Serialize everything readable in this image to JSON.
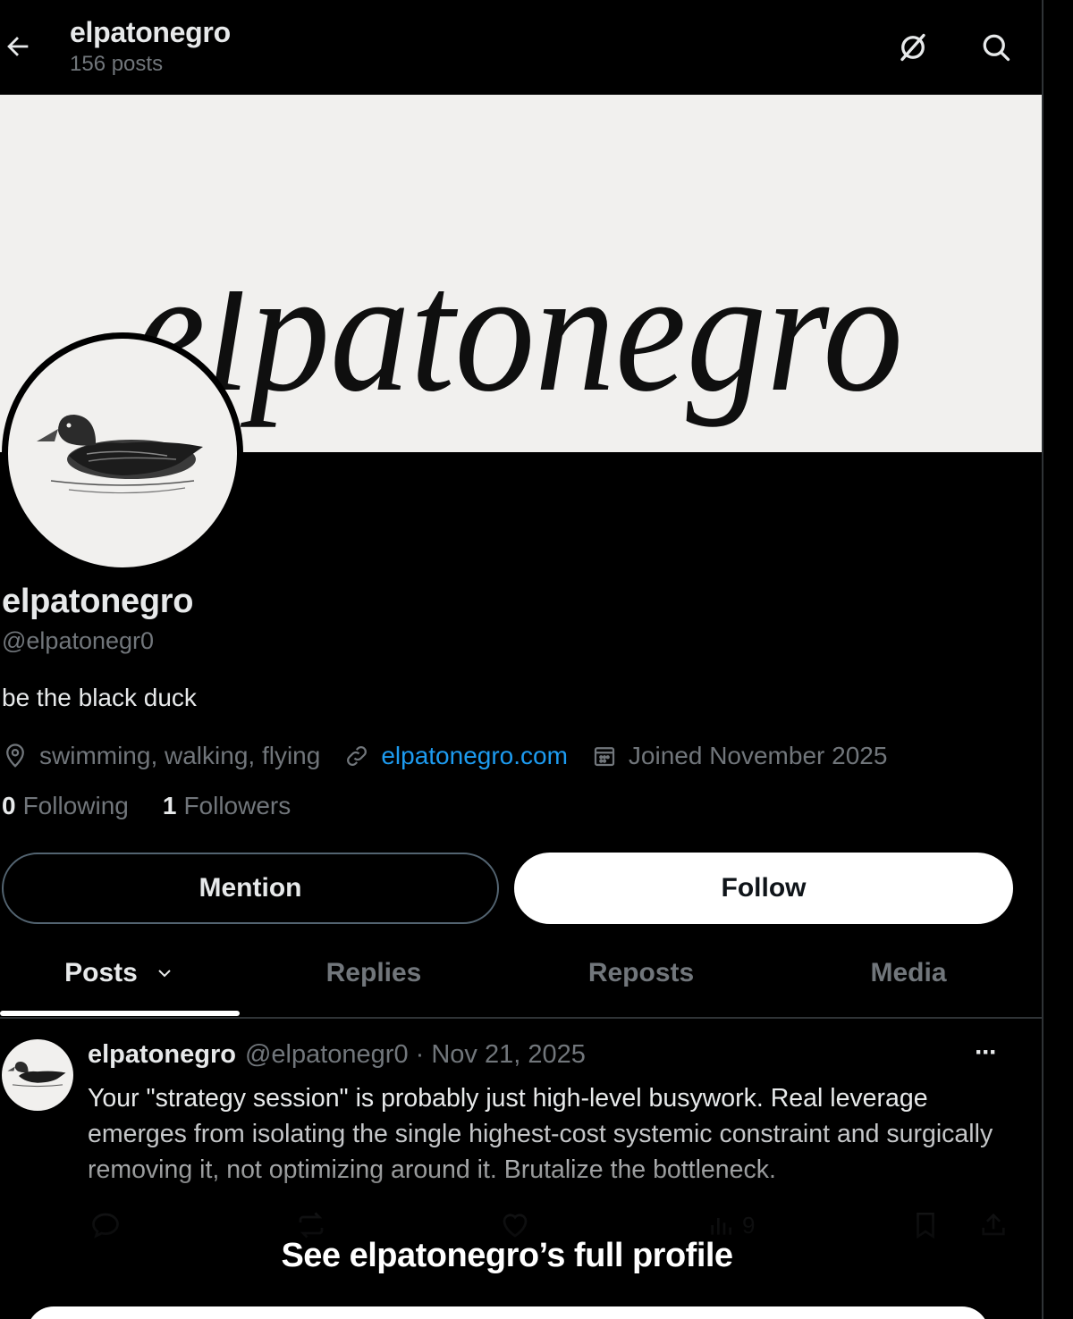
{
  "header": {
    "title": "elpatonegro",
    "post_count": "156 posts"
  },
  "banner": {
    "wordmark": "elpatonegro"
  },
  "profile": {
    "display_name": "elpatonegro",
    "handle": "@elpatonegr0",
    "bio": "be the black duck",
    "location": "swimming, walking, flying",
    "website": "elpatonegro.com",
    "joined": "Joined November 2025",
    "following_count": "0",
    "following_label": "Following",
    "followers_count": "1",
    "followers_label": "Followers"
  },
  "buttons": {
    "mention": "Mention",
    "follow": "Follow"
  },
  "tabs": [
    {
      "label": "Posts",
      "active": true
    },
    {
      "label": "Replies",
      "active": false
    },
    {
      "label": "Reposts",
      "active": false
    },
    {
      "label": "Media",
      "active": false
    }
  ],
  "post": {
    "name": "elpatonegro",
    "handle_date": "@elpatonegr0 · Nov 21, 2025",
    "text_main": "Your \"strategy session\" is probably just high-level busywork. Real leverage",
    "text_faded": "emerges from isolating the single highest-cost systemic constraint and surgically removing it, not optimizing around it. Brutalize the bottleneck.",
    "views": "9",
    "more": "···"
  },
  "overlay": {
    "see_full_profile": "See elpatonegro’s full profile"
  },
  "icons": {
    "back": "arrow-left-icon",
    "grok": "grok-icon",
    "search": "search-icon",
    "location": "location-pin-icon",
    "link": "link-icon",
    "calendar": "calendar-icon",
    "chevron": "chevron-down-icon",
    "reply": "reply-icon",
    "repost": "repost-icon",
    "like": "heart-icon",
    "views": "views-icon",
    "bookmark": "bookmark-icon",
    "share": "share-icon"
  },
  "colors": {
    "background": "#000000",
    "text": "#e7e9ea",
    "muted": "#71767b",
    "link": "#1d9bf0",
    "banner": "#f1f0ee"
  }
}
